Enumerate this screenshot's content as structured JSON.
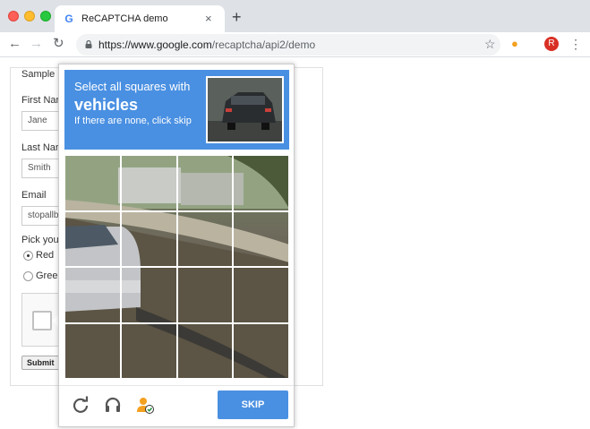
{
  "browser": {
    "tab_title": "ReCAPTCHA demo",
    "tab_favicon": "G",
    "tab_close": "×",
    "new_tab": "+",
    "url_host": "https://www.google.com",
    "url_path": "/recaptcha/api2/demo",
    "profile_initial": "R",
    "icons": {
      "back": "back-arrow-icon",
      "forward": "forward-arrow-icon",
      "reload": "reload-icon",
      "lock": "lock-icon",
      "star": "star-icon",
      "extension": "extension-icon",
      "menu": "kebab-menu-icon"
    }
  },
  "form": {
    "title": "Sample",
    "first_name_label": "First Nar",
    "first_name_value": "Jane",
    "last_name_label": "Last Nar",
    "last_name_value": "Smith",
    "email_label": "Email",
    "email_value": "stopallb",
    "pick_label": "Pick you",
    "radio_red": "Red",
    "radio_green": "Greer",
    "submit_label": "Submit"
  },
  "challenge": {
    "instruction": "Select all squares with",
    "target": "vehicles",
    "hint": "If there are none, click skip",
    "skip_label": "SKIP",
    "grid_rows": 4,
    "grid_cols": 4,
    "icons": {
      "reload": "reload-icon",
      "audio": "headphones-icon",
      "info": "user-help-icon"
    }
  },
  "colors": {
    "accent": "#4a90e2",
    "profile": "#d93025"
  }
}
